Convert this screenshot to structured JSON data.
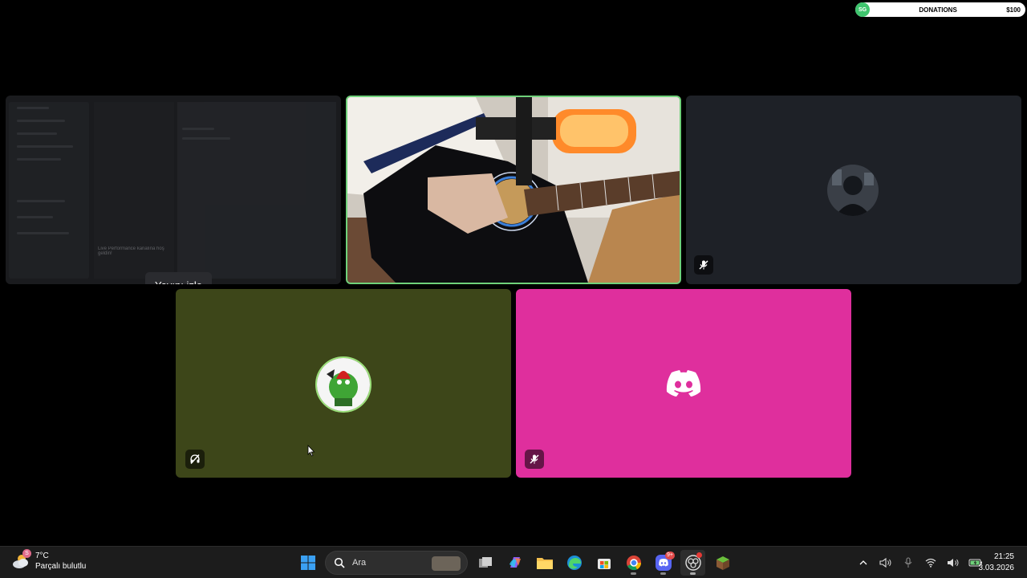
{
  "overlay": {
    "donation_badge": "SG",
    "donation_label": "DONATIONS",
    "donation_amount": "$100"
  },
  "tiles": {
    "screenshare": {
      "watch_button": "Yayını izle",
      "faded_heading": "Live Performance kanalına hoş geldin!"
    }
  },
  "taskbar": {
    "weather": {
      "temp": "7°C",
      "condition": "Parçalı bulutlu",
      "badge": "S"
    },
    "search_placeholder": "Ara",
    "discord_badge": "9+",
    "clock": {
      "time": "21:25",
      "date": "3.03.2026"
    }
  },
  "colors": {
    "speaking_border": "#6fd17a",
    "tile_user4": "#3d4619",
    "tile_user5": "#df2f9d"
  }
}
